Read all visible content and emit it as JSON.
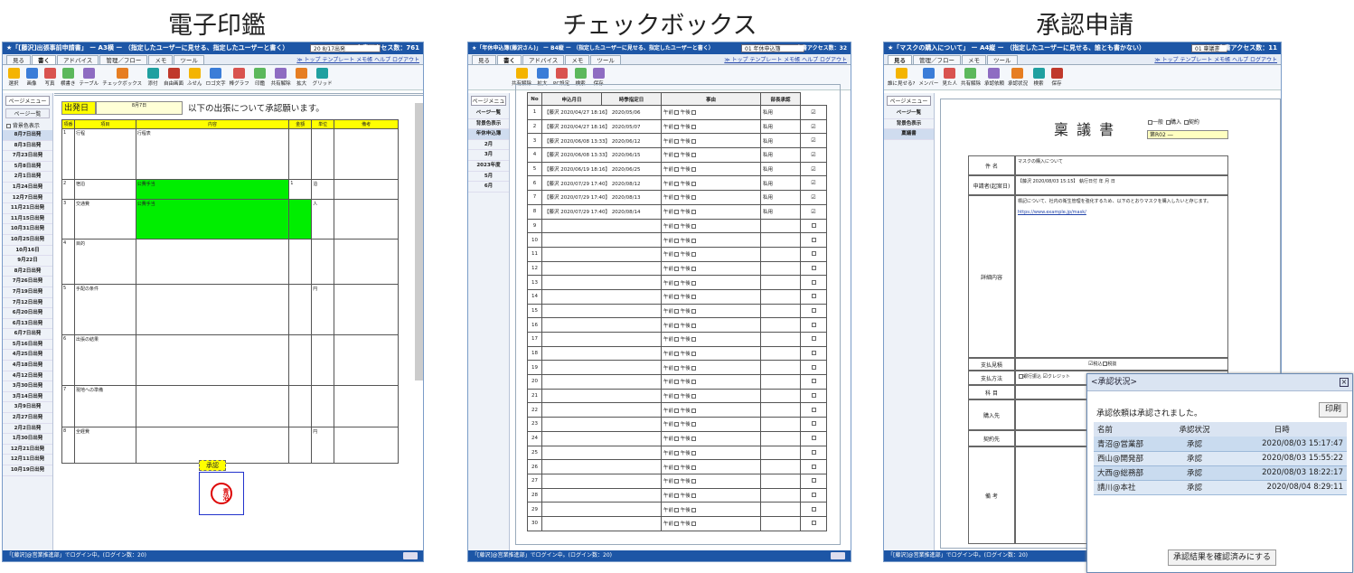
{
  "captions": [
    "電子印鑑",
    "チェックボックス",
    "承認申請"
  ],
  "w1": {
    "title": "★「[藤沢]出張事前申請書」 ー A3横 ー （指定したユーザーに見せる、指定したユーザーと書く）",
    "select": "20 8/17出発",
    "access": "文書アクセス数：761",
    "tabs": [
      "見る",
      "書く",
      "アドバイス",
      "管理／フロー",
      "メモ",
      "ツール"
    ],
    "links": "≫ トップ テンプレート メモ帳 ヘルプ ログアウト",
    "tools": [
      "選択",
      "画像",
      "写真",
      "横書き",
      "テーブル",
      "チェックボックス",
      "添付",
      "自由画面",
      "ふせん",
      "ロゴ文字",
      "棒グラフ",
      "印鑑",
      "共有解除",
      "拡大",
      "グリッド"
    ],
    "side_btn": "ページメニュー",
    "side_label": "ページ一覧",
    "side_check": "背景色表示",
    "pages": [
      "8月7日出発",
      "8月3日出発",
      "7月23日出発",
      "5月8日出発",
      "2月1日出発",
      "1月24日出発",
      "12月7日出発",
      "11月21日出発",
      "11月15日出発",
      "10月31日出発",
      "10月25日出発",
      "10月16日",
      "9月22日",
      "8月2日出発",
      "7月26日出発",
      "7月19日出発",
      "7月12日出発",
      "6月20日出発",
      "6月13日出発",
      "6月7日出発",
      "5月16日出発",
      "4月25日出発",
      "4月18日出発",
      "4月12日出発",
      "3月30日出発",
      "3月14日出発",
      "3月9日出発",
      "2月27日出発",
      "2月2日出発",
      "1月30日出発",
      "12月21日出発",
      "12月11日出発",
      "10月19日出発"
    ],
    "depart_label": "出発日",
    "depart_val": "8月7日",
    "request_text": "以下の出張について承認願います。",
    "headers": [
      "項番",
      "項目",
      "内容",
      "金額",
      "単位",
      "備考"
    ],
    "rows": [
      [
        "1",
        "行程",
        "行程表",
        "",
        "",
        ""
      ],
      [
        "2",
        "宿泊",
        "公費手当",
        "1",
        "泊",
        ""
      ],
      [
        "3",
        "交通費",
        "公費手当",
        "",
        "人",
        ""
      ],
      [
        "4",
        "目的",
        "",
        "",
        "",
        ""
      ],
      [
        "5",
        "手配の条件",
        "",
        "",
        "円",
        ""
      ],
      [
        "6",
        "出張の結果",
        "",
        "",
        "",
        ""
      ],
      [
        "7",
        "現地への準備",
        "",
        "",
        "",
        ""
      ],
      [
        "8",
        "全経費",
        "",
        "",
        "円",
        ""
      ]
    ],
    "stamp_label": "承認",
    "stamp_name": "青沼",
    "status": "「[藤沢]@営業推進部」でログイン中。(ログイン数：20)"
  },
  "w2": {
    "title": "★「年休申込簿(藤沢さん)」 ー B4縦 ー （指定したユーザーに見せる、指定したユーザーと書く）",
    "select": "01 年休申込簿",
    "access": "文書アクセス数：32",
    "tabs": [
      "見る",
      "書く",
      "アドバイス",
      "メモ",
      "ツール"
    ],
    "links": "≫ トップ テンプレート メモ帳 ヘルプ ログアウト",
    "tools": [
      "共有解除",
      "拡大",
      "PC設定",
      "検索",
      "保存"
    ],
    "side_btn": "ページメニュー",
    "side_items": [
      "ページ一覧",
      "背景色表示",
      "年休申込簿",
      "2月",
      "3月",
      "2023年度",
      "5月",
      "6月"
    ],
    "headers": [
      "No",
      "申込月日",
      "時季指定日",
      "事由",
      "部長承認"
    ],
    "am": "午前",
    "pm": "午後",
    "rows": [
      {
        "no": "1",
        "apply": "【藤沢 2020/04/27 18:16】",
        "date": "2020/05/06",
        "reason": "私用",
        "ok": true
      },
      {
        "no": "2",
        "apply": "【藤沢 2020/04/27 18:16】",
        "date": "2020/05/07",
        "reason": "私用",
        "ok": true
      },
      {
        "no": "3",
        "apply": "【藤沢 2020/06/08 13:33】",
        "date": "2020/06/12",
        "reason": "私用",
        "ok": true
      },
      {
        "no": "4",
        "apply": "【藤沢 2020/06/08 13:33】",
        "date": "2020/06/15",
        "reason": "私用",
        "ok": true
      },
      {
        "no": "5",
        "apply": "【藤沢 2020/06/19 18:16】",
        "date": "2020/06/25",
        "reason": "私用",
        "ok": true
      },
      {
        "no": "6",
        "apply": "【藤沢 2020/07/29 17:40】",
        "date": "2020/08/12",
        "reason": "私用",
        "ok": true
      },
      {
        "no": "7",
        "apply": "【藤沢 2020/07/29 17:40】",
        "date": "2020/08/13",
        "reason": "私用",
        "ok": true
      },
      {
        "no": "8",
        "apply": "【藤沢 2020/07/29 17:40】",
        "date": "2020/08/14",
        "reason": "私用",
        "ok": true
      }
    ],
    "empty_from": 9,
    "empty_to": 30,
    "status": "「[藤沢]@営業推進部」でログイン中。(ログイン数：20)"
  },
  "w3": {
    "title": "★「マスクの購入について」 ー A4縦 ー （指定したユーザーに見せる、誰とも書かない）",
    "select": "01 稟議書",
    "access": "文書アクセス数：11",
    "tabs": [
      "見る",
      "管理／フロー",
      "メモ",
      "ツール"
    ],
    "links": "≫ トップ テンプレート メモ帳 ヘルプ ログアウト",
    "tools": [
      "誰に見せる?",
      "メンバー",
      "見た人",
      "共有解除",
      "承認依頼",
      "承認状況",
      "検索",
      "保存"
    ],
    "side_btn": "ページメニュー",
    "side_items": [
      "ページ一覧",
      "背景色表示",
      "稟議書"
    ],
    "doc_title": "稟 議 書",
    "doc_checks": [
      "一般",
      "購入",
      "契約"
    ],
    "doc_no": "第R02 ―",
    "row_labels": [
      "件 名",
      "申請者(起案日)",
      "詳細内容",
      "支払見積",
      "支払方法",
      "科 目",
      "購入先",
      "契約先",
      "備 考"
    ],
    "subject": "マスクの購入について",
    "applicant": "【藤沢 2020/08/03 15:15】",
    "exec_date": "執行日付",
    "year": "年",
    "month": "月",
    "day": "日",
    "detail": "標記について、社内の衛生管理を強化するため、以下のとおりマスクを購入したいと存じます。",
    "url": "https://www.example.jp/mask/",
    "pay_checks": [
      "税込",
      "税抜"
    ],
    "pay_methods": [
      "銀行振込",
      "クレジット"
    ],
    "status": "「[藤沢]@営業推進部」でログイン中。(ログイン数：20)",
    "panel": {
      "title": "<承認状況>",
      "message": "承認依頼は承認されました。",
      "print": "印刷",
      "headers": [
        "名前",
        "承認状況",
        "日時"
      ],
      "rows": [
        [
          "青沼@営業部",
          "承認",
          "2020/08/03 15:17:47"
        ],
        [
          "西山@開発部",
          "承認",
          "2020/08/03 15:55:22"
        ],
        [
          "大西@総務部",
          "承認",
          "2020/08/03 18:22:17"
        ],
        [
          "請川@本社",
          "承認",
          "2020/08/04 8:29:11"
        ]
      ],
      "confirm": "承認結果を確認済みにする"
    }
  }
}
